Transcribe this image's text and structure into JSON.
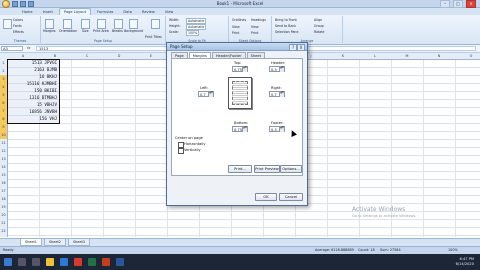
{
  "window": {
    "title": "Book1 - Microsoft Excel"
  },
  "ribbon": {
    "tabs": [
      "Home",
      "Insert",
      "Page Layout",
      "Formulas",
      "Data",
      "Review",
      "View"
    ],
    "active_tab": "Page Layout",
    "groups": [
      {
        "label": "Themes",
        "items": [
          "Colors",
          "Fonts",
          "Effects"
        ]
      },
      {
        "label": "Page Setup",
        "items": [
          "Margins",
          "Orientation",
          "Size",
          "Print Area",
          "Breaks",
          "Background",
          "Print Titles"
        ]
      },
      {
        "label": "Scale to Fit",
        "items": [
          "Width:",
          "Height:",
          "Scale:"
        ],
        "values": [
          "Automatic",
          "Automatic",
          "100%"
        ]
      },
      {
        "label": "Sheet Options",
        "items": [
          "Gridlines",
          "Headings",
          "View",
          "Print"
        ]
      },
      {
        "label": "Arrange",
        "items": [
          "Bring to Front",
          "Send to Back",
          "Selection Pane",
          "Align",
          "Group",
          "Rotate"
        ]
      }
    ]
  },
  "formula_bar": {
    "name_box": "A3",
    "fx": "fx",
    "value": "1513"
  },
  "columns": [
    "A",
    "B",
    "C",
    "D",
    "E",
    "F",
    "G",
    "H",
    "I",
    "J",
    "K",
    "L",
    "M",
    "N",
    "O"
  ],
  "rows": [
    "1",
    "2",
    "3",
    "4",
    "5",
    "6",
    "7",
    "8",
    "9",
    "10",
    "11",
    "12",
    "13",
    "14",
    "15",
    "16",
    "17",
    "18",
    "19",
    "20",
    "21",
    "22"
  ],
  "cells": [
    "1513 JPVGC",
    "2163 BJMB",
    "16 BKHJ",
    "15116 KJMBHI",
    "150 BKIBI",
    "1316 BTMBHJ",
    "15 VBHJV",
    "16856 JNVBH",
    "156 VHJ"
  ],
  "dialog": {
    "title": "Page Setup",
    "help": "?",
    "close": "X",
    "tabs": [
      "Page",
      "Margins",
      "Header/Footer",
      "Sheet"
    ],
    "active_tab": "Margins",
    "top_label": "Top:",
    "top_value": "0.75",
    "header_label": "Header:",
    "header_value": "0.3",
    "left_label": "Left:",
    "left_value": "0.7",
    "right_label": "Right:",
    "right_value": "0.7",
    "bottom_label": "Bottom:",
    "bottom_value": "0.75",
    "footer_label": "Footer:",
    "footer_value": "0.3",
    "center_label": "Center on page",
    "horizontally": "Horizontally",
    "vertically": "Vertically",
    "print_btn": "Print...",
    "preview_btn": "Print Preview",
    "options_btn": "Options...",
    "ok_btn": "OK",
    "cancel_btn": "Cancel"
  },
  "sheets": [
    "Sheet1",
    "Sheet2",
    "Sheet3"
  ],
  "active_sheet": "Sheet1",
  "status": {
    "ready": "Ready",
    "average": "Average: 6128.888889",
    "count": "Count: 18",
    "sum": "Sum: 27584",
    "zoom": "100%"
  },
  "watermark": {
    "line1": "Activate Windows",
    "line2": "Go to Settings to activate Windows."
  },
  "taskbar": {
    "time": "6:47 PM",
    "date": "6/14/2020"
  },
  "colors": {
    "accent": "#c5d6ec",
    "selection": "#f5c95c",
    "taskbar": "#1c2636"
  }
}
